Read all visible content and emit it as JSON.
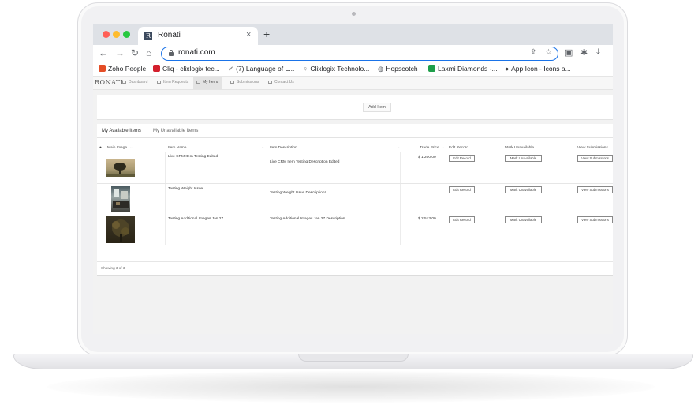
{
  "browser": {
    "tab_title": "Ronati",
    "tab_favicon_letter": "R",
    "tab_close": "×",
    "new_tab": "+",
    "url": "ronati.com",
    "bookmarks": [
      {
        "label": "Zoho People",
        "icon": "zoho-icon",
        "color": "#e44d26"
      },
      {
        "label": "Cliq - clixlogix tec...",
        "icon": "cliq-icon",
        "color": "#d3202d"
      },
      {
        "label": "(7) Language of L...",
        "icon": "checkmark-icon",
        "color": "#8a8a8a"
      },
      {
        "label": "Clixlogix Technolo...",
        "icon": "bulb-icon",
        "color": "#777777"
      },
      {
        "label": "Hopscotch",
        "icon": "globe-icon",
        "color": "#5f6368"
      },
      {
        "label": "Laxmi Diamonds -...",
        "icon": "plus-icon",
        "color": "#1e9e4a"
      },
      {
        "label": "App Icon - Icons a...",
        "icon": "apple-icon",
        "color": "#444444"
      }
    ]
  },
  "app": {
    "brand": "RONATI",
    "nav": [
      {
        "label": "Dashboard",
        "active": false
      },
      {
        "label": "Item Requests",
        "active": false
      },
      {
        "label": "My Items",
        "active": true
      },
      {
        "label": "Submissions",
        "active": false
      },
      {
        "label": "Contact Us",
        "active": false
      }
    ],
    "add_item_label": "Add Item",
    "tabs": [
      {
        "label": "My Available Items",
        "active": true
      },
      {
        "label": "My Unavailable Items",
        "active": false
      }
    ],
    "columns": {
      "main_image": "Main Image",
      "item_name": "Item Name",
      "item_description": "Item Description",
      "trade_price": "Trade Price",
      "edit_record": "Edit Record",
      "mark_unavailable": "Mark Unavailable",
      "view_submissions": "View Submissions"
    },
    "rows": [
      {
        "name": "Live CRM Item Testing Edited",
        "description": "Live CRM Item Testing Description Edited",
        "price": "$ 1,200.00",
        "edit": "Edit Record",
        "mark": "Mark Unavailable",
        "view": "View Submissions"
      },
      {
        "name": "Testing Weight Issue",
        "description": "Testing Weight Issue Description!",
        "price": "",
        "edit": "Edit Record",
        "mark": "Mark Unavailable",
        "view": "View Submissions"
      },
      {
        "name": "Testing Additional Images Jan 27",
        "description": "Testing Additional Images Jan 27 Description",
        "price": "$ 2,513.00",
        "edit": "Edit Record",
        "mark": "Mark Unavailable",
        "view": "View Submissions"
      }
    ],
    "footer": "Showing 3 of 3"
  }
}
